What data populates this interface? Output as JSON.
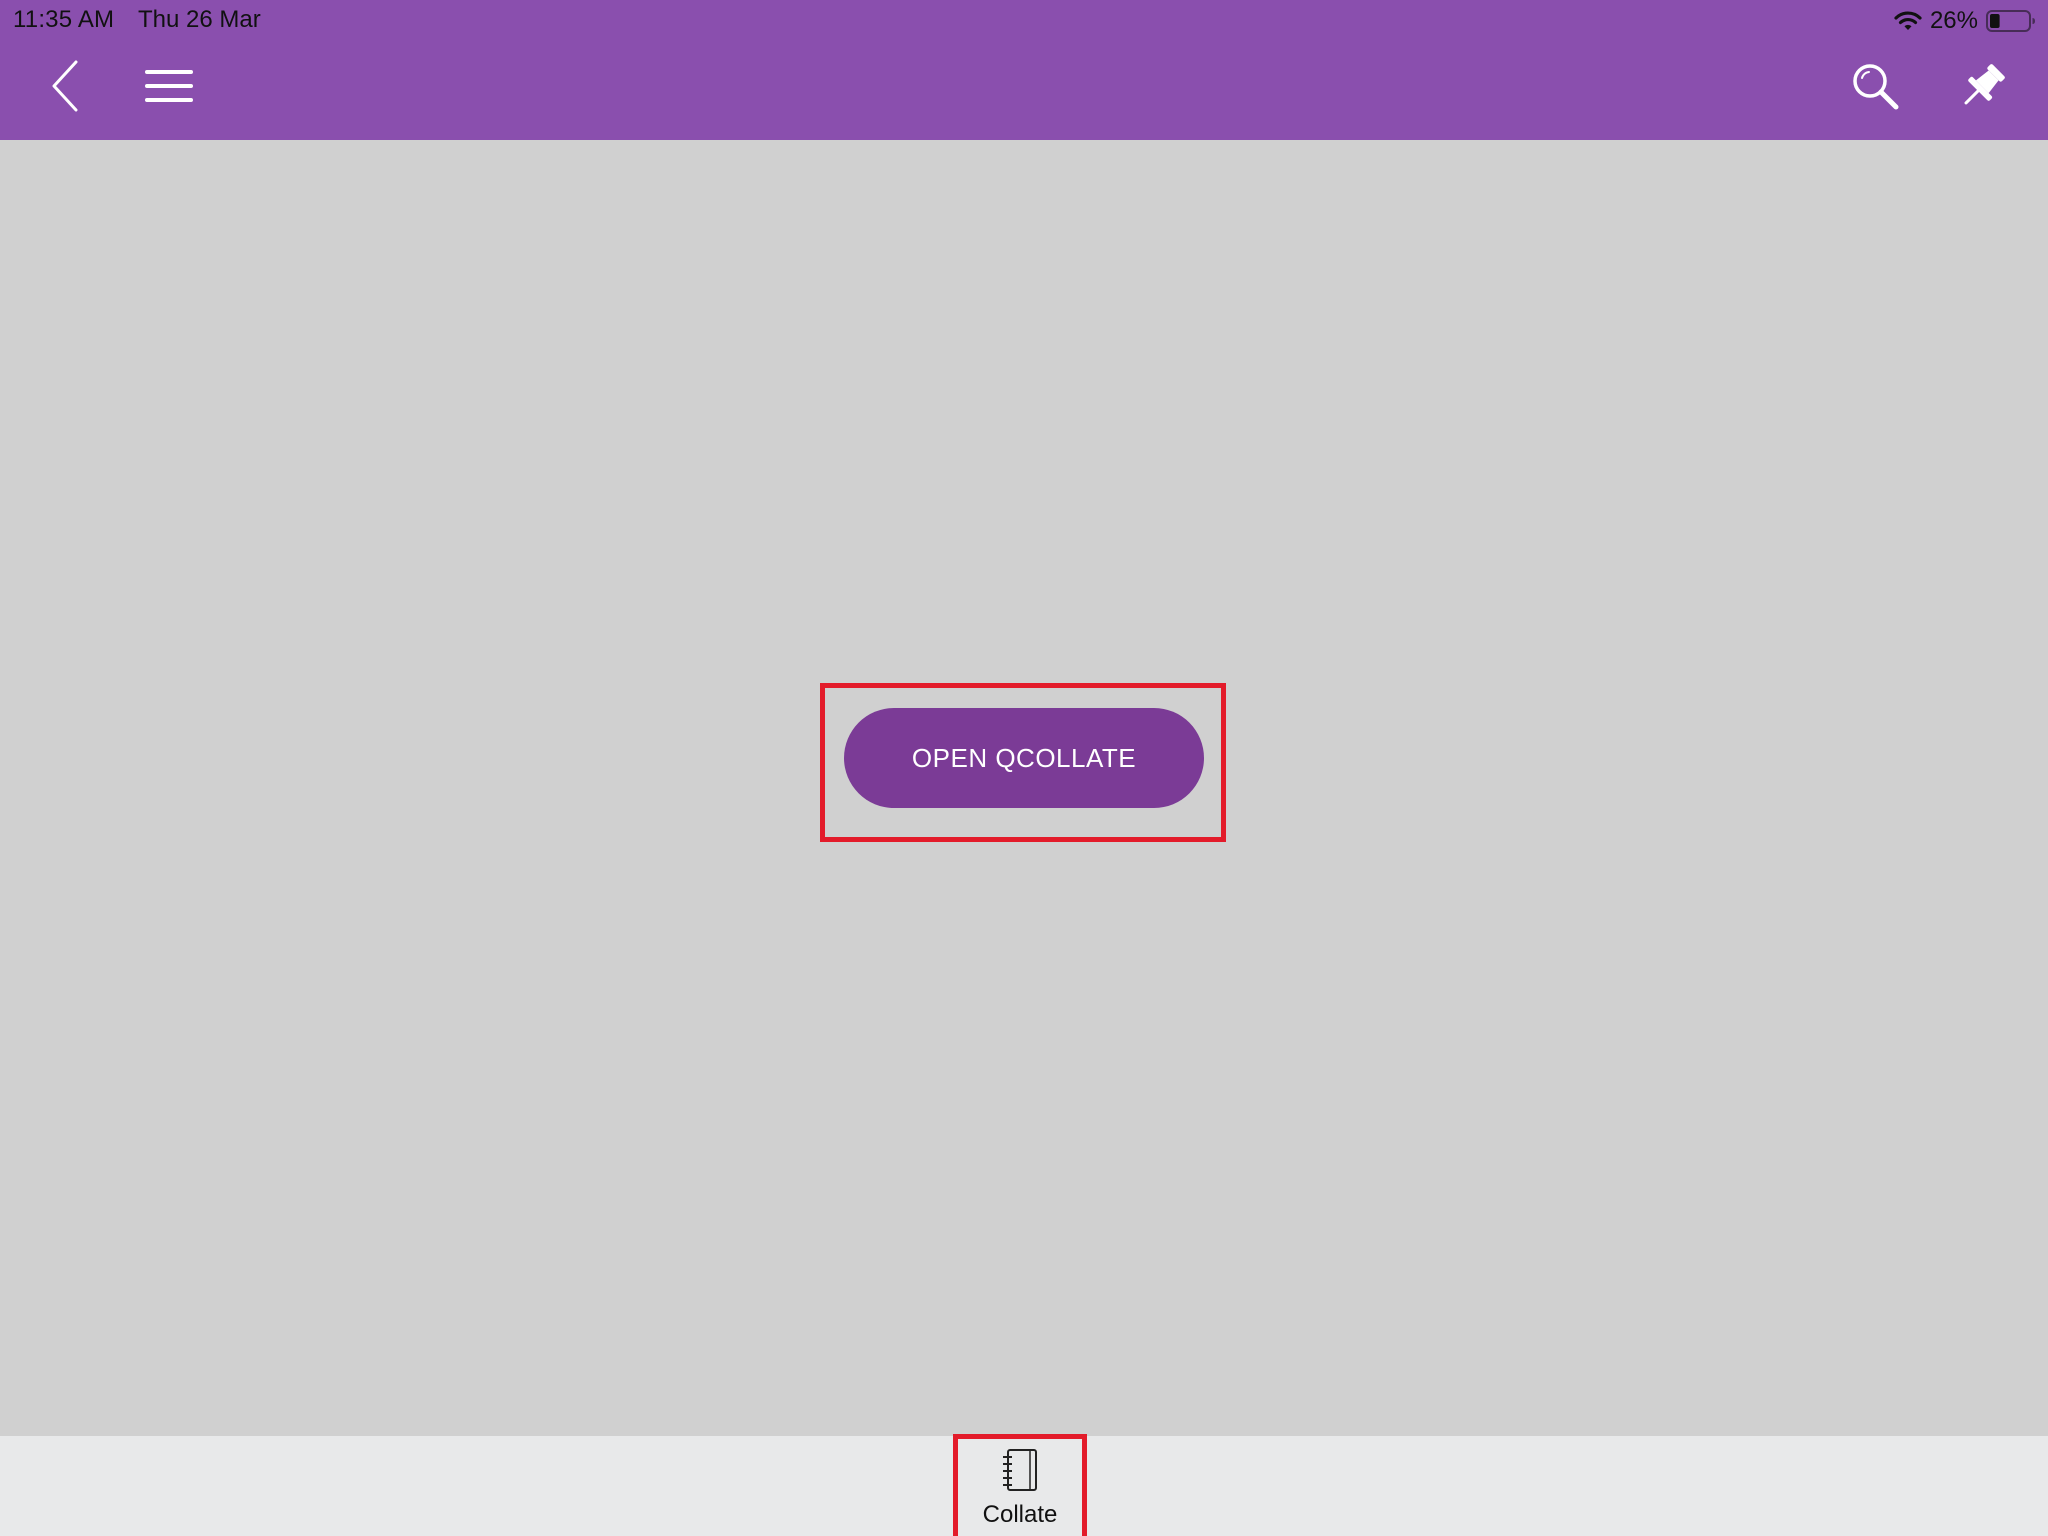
{
  "status_bar": {
    "time": "11:35 AM",
    "date": "Thu 26 Mar",
    "battery_percent": "26%",
    "battery_level": 0.26
  },
  "header": {
    "background_color": "#8a4fae",
    "icons": {
      "back": "chevron-left-icon",
      "menu": "hamburger-menu-icon",
      "search": "search-icon",
      "pin": "pin-icon"
    }
  },
  "main": {
    "open_button_label": "OPEN QCOLLATE",
    "button_color": "#7b3b96",
    "highlight_color": "#e31b2a"
  },
  "tabbar": {
    "items": [
      {
        "label": "Collate",
        "icon": "notebook-icon"
      }
    ]
  }
}
